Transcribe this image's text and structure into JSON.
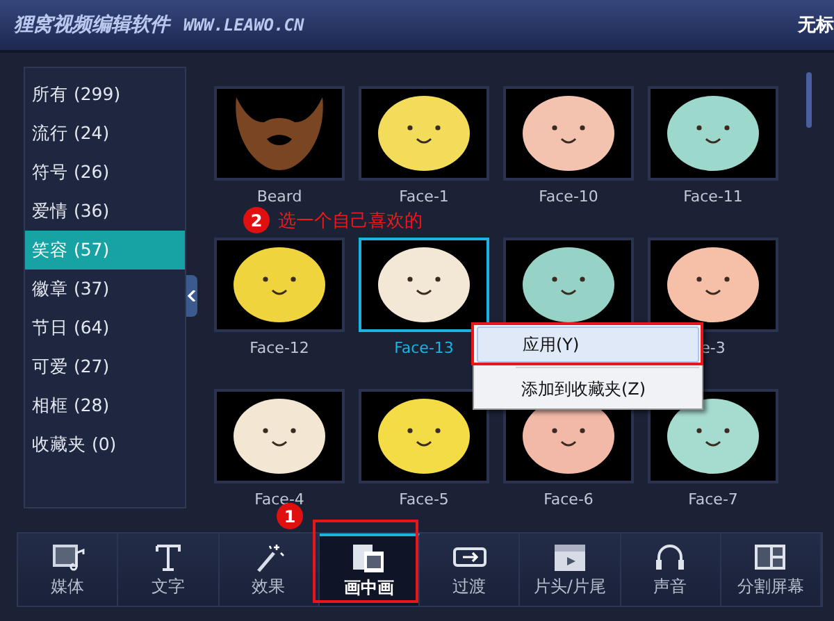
{
  "window": {
    "title": "狸窝视频编辑软件",
    "url": "WWW.LEAWO.CN",
    "document_title": "无标"
  },
  "categories": [
    {
      "label": "所有 (299)",
      "selected": false
    },
    {
      "label": "流行 (24)",
      "selected": false
    },
    {
      "label": "符号 (26)",
      "selected": false
    },
    {
      "label": "爱情 (36)",
      "selected": false
    },
    {
      "label": "笑容 (57)",
      "selected": true
    },
    {
      "label": "徽章 (37)",
      "selected": false
    },
    {
      "label": "节日 (64)",
      "selected": false
    },
    {
      "label": "可爱 (27)",
      "selected": false
    },
    {
      "label": "相框 (28)",
      "selected": false
    },
    {
      "label": "收藏夹 (0)",
      "selected": false
    }
  ],
  "thumbnails": [
    {
      "label": "Beard",
      "kind": "beard",
      "selected": false
    },
    {
      "label": "Face-1",
      "kind": "face",
      "color": "#f2dc5a",
      "selected": false
    },
    {
      "label": "Face-10",
      "kind": "face",
      "color": "#f4c3b0",
      "selected": false
    },
    {
      "label": "Face-11",
      "kind": "face",
      "color": "#9dd8cc",
      "selected": false
    },
    {
      "label": "Face-12",
      "kind": "face",
      "color": "#f0d43e",
      "selected": false
    },
    {
      "label": "Face-13",
      "kind": "face",
      "color": "#f3e8d6",
      "selected": true
    },
    {
      "kind": "face",
      "color": "#96d3c6",
      "selected": false
    },
    {
      "label": "e-3",
      "kind": "face",
      "color": "#f6c0a8",
      "selected": false
    },
    {
      "label": "Face-4",
      "kind": "face",
      "color": "#f3e6d2",
      "selected": false
    },
    {
      "label": "Face-5",
      "kind": "face",
      "color": "#f4dc46",
      "selected": false
    },
    {
      "label": "Face-6",
      "kind": "face",
      "color": "#f3b9a8",
      "selected": false
    },
    {
      "label": "Face-7",
      "kind": "face",
      "color": "#a6dccf",
      "selected": false
    }
  ],
  "context_menu": [
    {
      "label": "应用(Y)",
      "selected": true
    },
    {
      "label": "添加到收藏夹(Z)",
      "selected": false
    }
  ],
  "annotations": [
    {
      "number": "2",
      "text": "选一个自己喜欢的"
    },
    {
      "number": "1"
    }
  ],
  "toolbar": [
    {
      "label": "媒体",
      "selected": false
    },
    {
      "label": "文字",
      "selected": false
    },
    {
      "label": "效果",
      "selected": false
    },
    {
      "label": "画中画",
      "selected": true
    },
    {
      "label": "过渡",
      "selected": false
    },
    {
      "label": "片头/片尾",
      "selected": false
    },
    {
      "label": "声音",
      "selected": false
    },
    {
      "label": "分割屏幕",
      "selected": false
    }
  ]
}
